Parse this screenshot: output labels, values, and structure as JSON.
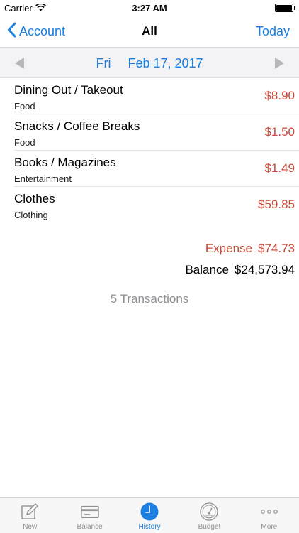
{
  "status_bar": {
    "carrier": "Carrier",
    "time": "3:27 AM",
    "wifi_icon": "wifi-icon",
    "battery_icon": "battery-icon"
  },
  "nav": {
    "back_label": "Account",
    "back_icon": "chevron-left-icon",
    "title": "All",
    "right_label": "Today"
  },
  "date_bar": {
    "day_of_week": "Fri",
    "date": "Feb 17, 2017",
    "prev_icon": "triangle-left-icon",
    "next_icon": "triangle-right-icon"
  },
  "transactions": [
    {
      "title": "Dining Out / Takeout",
      "category": "Food",
      "amount": "$8.90"
    },
    {
      "title": "Snacks / Coffee Breaks",
      "category": "Food",
      "amount": "$1.50"
    },
    {
      "title": "Books / Magazines",
      "category": "Entertainment",
      "amount": "$1.49"
    },
    {
      "title": "Clothes",
      "category": "Clothing",
      "amount": "$59.85"
    }
  ],
  "totals": {
    "expense_label": "Expense",
    "expense_value": "$74.73",
    "balance_label": "Balance",
    "balance_value": "$24,573.94"
  },
  "transaction_count": "5 Transactions",
  "tabs": [
    {
      "label": "New",
      "icon": "edit-icon",
      "active": false
    },
    {
      "label": "Balance",
      "icon": "card-icon",
      "active": false
    },
    {
      "label": "History",
      "icon": "clock-icon",
      "active": true
    },
    {
      "label": "Budget",
      "icon": "gauge-icon",
      "active": false
    },
    {
      "label": "More",
      "icon": "ellipsis-icon",
      "active": false
    }
  ],
  "colors": {
    "accent": "#1a7fe0",
    "expense": "#c9483a",
    "inactive_tab": "#929292"
  }
}
